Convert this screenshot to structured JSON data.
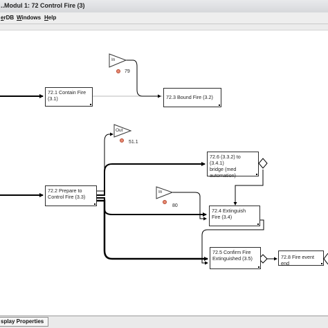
{
  "window": {
    "title": "..Modul 1: 72 Control Fire (3)"
  },
  "menu": [
    {
      "label": "erDB"
    },
    {
      "label": "Windows"
    },
    {
      "label": "Help"
    }
  ],
  "nodes": {
    "contain_fire": {
      "lines": [
        "72.1 Contain Fire",
        "(3.1)"
      ]
    },
    "bound_fire": {
      "lines": [
        "72.3 Bound Fire (3.2)"
      ]
    },
    "prepare": {
      "lines": [
        "72.2 Prepare to",
        "Control Fire (3.3)"
      ]
    },
    "bridge": {
      "lines": [
        "72.6 (3.3.2) to (3.4.1)",
        "bridge (med",
        "automation)"
      ]
    },
    "extinguish": {
      "lines": [
        "72.4 Extinguish",
        "Fire (3.4)"
      ]
    },
    "confirm": {
      "lines": [
        "72.5 Confirm Fire",
        "Extinguished (3.5)"
      ]
    },
    "fire_event_end": {
      "lines": [
        "72.8 Fire event end"
      ]
    }
  },
  "connectors": {
    "in_top": {
      "label": "In",
      "value": "79"
    },
    "out": {
      "label": "Out",
      "value": "51.1"
    },
    "in_mid": {
      "label": "In",
      "value": "80"
    }
  },
  "status": {
    "tab_label": "splay Properties"
  }
}
